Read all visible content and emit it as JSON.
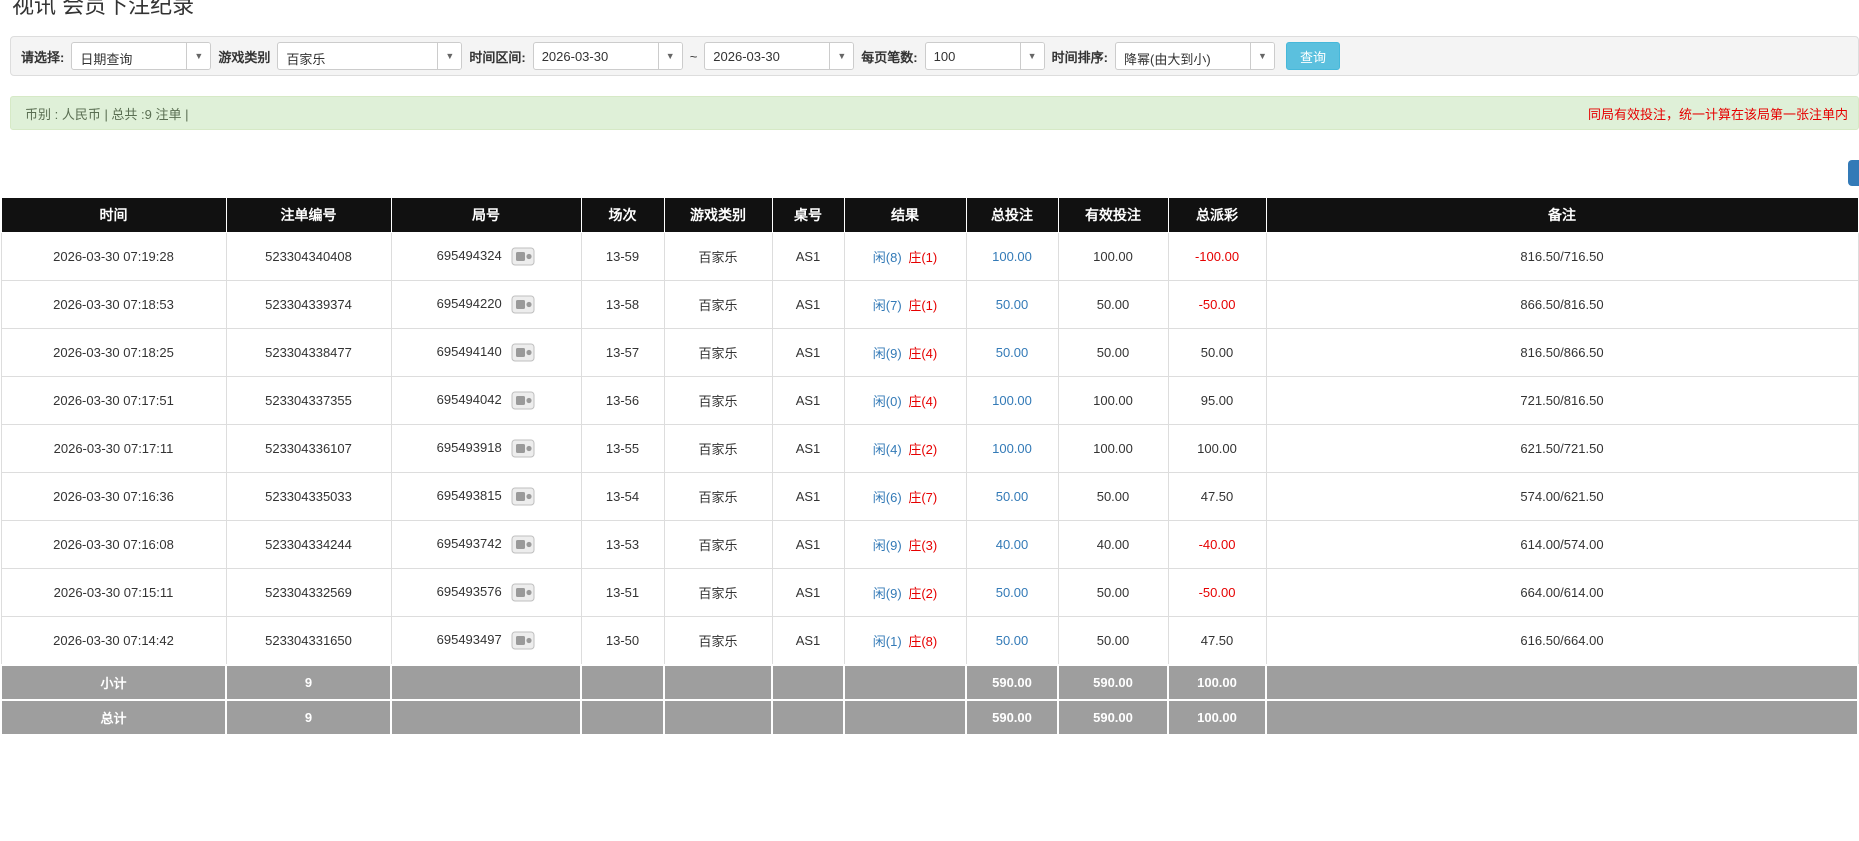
{
  "page": {
    "title": "视讯 会员下注纪录"
  },
  "colors": {
    "link_blue": "#337ab7",
    "negative_red": "#e60000",
    "header_bg": "#111111",
    "footer_bg": "#9e9e9e",
    "success_bg": "#dff0d8",
    "query_button_bg": "#5bc0de"
  },
  "filters": {
    "select": {
      "label": "请选择:",
      "value": "日期查询"
    },
    "game": {
      "label": "游戏类别",
      "value": "百家乐"
    },
    "range": {
      "label": "时间区间:",
      "from": "2026-03-30",
      "separator": "~",
      "to": "2026-03-30"
    },
    "per_page": {
      "label": "每页笔数:",
      "value": "100"
    },
    "sort": {
      "label": "时间排序:",
      "value": "降幂(由大到小)"
    },
    "query_button": "查询"
  },
  "summary": {
    "left": "币别 : 人民币 | 总共 :9 注单 |",
    "right": "同局有效投注，统一计算在该局第一张注单内"
  },
  "table": {
    "headers": [
      "时间",
      "注单编号",
      "局号",
      "场次",
      "游戏类别",
      "桌号",
      "结果",
      "总投注",
      "有效投注",
      "总派彩",
      "备注"
    ],
    "rows": [
      {
        "time": "2026-03-30 07:19:28",
        "bet_id": "523304340408",
        "round_id": "695494324",
        "session": "13-59",
        "game": "百家乐",
        "table_no": "AS1",
        "result_player": "闲(8)",
        "result_banker": "庄(1)",
        "total_bet": "100.00",
        "valid_bet": "100.00",
        "payout": "-100.00",
        "remark": "816.50/716.50"
      },
      {
        "time": "2026-03-30 07:18:53",
        "bet_id": "523304339374",
        "round_id": "695494220",
        "session": "13-58",
        "game": "百家乐",
        "table_no": "AS1",
        "result_player": "闲(7)",
        "result_banker": "庄(1)",
        "total_bet": "50.00",
        "valid_bet": "50.00",
        "payout": "-50.00",
        "remark": "866.50/816.50"
      },
      {
        "time": "2026-03-30 07:18:25",
        "bet_id": "523304338477",
        "round_id": "695494140",
        "session": "13-57",
        "game": "百家乐",
        "table_no": "AS1",
        "result_player": "闲(9)",
        "result_banker": "庄(4)",
        "total_bet": "50.00",
        "valid_bet": "50.00",
        "payout": "50.00",
        "remark": "816.50/866.50"
      },
      {
        "time": "2026-03-30 07:17:51",
        "bet_id": "523304337355",
        "round_id": "695494042",
        "session": "13-56",
        "game": "百家乐",
        "table_no": "AS1",
        "result_player": "闲(0)",
        "result_banker": "庄(4)",
        "total_bet": "100.00",
        "valid_bet": "100.00",
        "payout": "95.00",
        "remark": "721.50/816.50"
      },
      {
        "time": "2026-03-30 07:17:11",
        "bet_id": "523304336107",
        "round_id": "695493918",
        "session": "13-55",
        "game": "百家乐",
        "table_no": "AS1",
        "result_player": "闲(4)",
        "result_banker": "庄(2)",
        "total_bet": "100.00",
        "valid_bet": "100.00",
        "payout": "100.00",
        "remark": "621.50/721.50"
      },
      {
        "time": "2026-03-30 07:16:36",
        "bet_id": "523304335033",
        "round_id": "695493815",
        "session": "13-54",
        "game": "百家乐",
        "table_no": "AS1",
        "result_player": "闲(6)",
        "result_banker": "庄(7)",
        "total_bet": "50.00",
        "valid_bet": "50.00",
        "payout": "47.50",
        "remark": "574.00/621.50"
      },
      {
        "time": "2026-03-30 07:16:08",
        "bet_id": "523304334244",
        "round_id": "695493742",
        "session": "13-53",
        "game": "百家乐",
        "table_no": "AS1",
        "result_player": "闲(9)",
        "result_banker": "庄(3)",
        "total_bet": "40.00",
        "valid_bet": "40.00",
        "payout": "-40.00",
        "remark": "614.00/574.00"
      },
      {
        "time": "2026-03-30 07:15:11",
        "bet_id": "523304332569",
        "round_id": "695493576",
        "session": "13-51",
        "game": "百家乐",
        "table_no": "AS1",
        "result_player": "闲(9)",
        "result_banker": "庄(2)",
        "total_bet": "50.00",
        "valid_bet": "50.00",
        "payout": "-50.00",
        "remark": "664.00/614.00"
      },
      {
        "time": "2026-03-30 07:14:42",
        "bet_id": "523304331650",
        "round_id": "695493497",
        "session": "13-50",
        "game": "百家乐",
        "table_no": "AS1",
        "result_player": "闲(1)",
        "result_banker": "庄(8)",
        "total_bet": "50.00",
        "valid_bet": "50.00",
        "payout": "47.50",
        "remark": "616.50/664.00"
      }
    ],
    "subtotal": {
      "label": "小计",
      "count": "9",
      "total_bet": "590.00",
      "valid_bet": "590.00",
      "payout": "100.00"
    },
    "total": {
      "label": "总计",
      "count": "9",
      "total_bet": "590.00",
      "valid_bet": "590.00",
      "payout": "100.00"
    }
  }
}
